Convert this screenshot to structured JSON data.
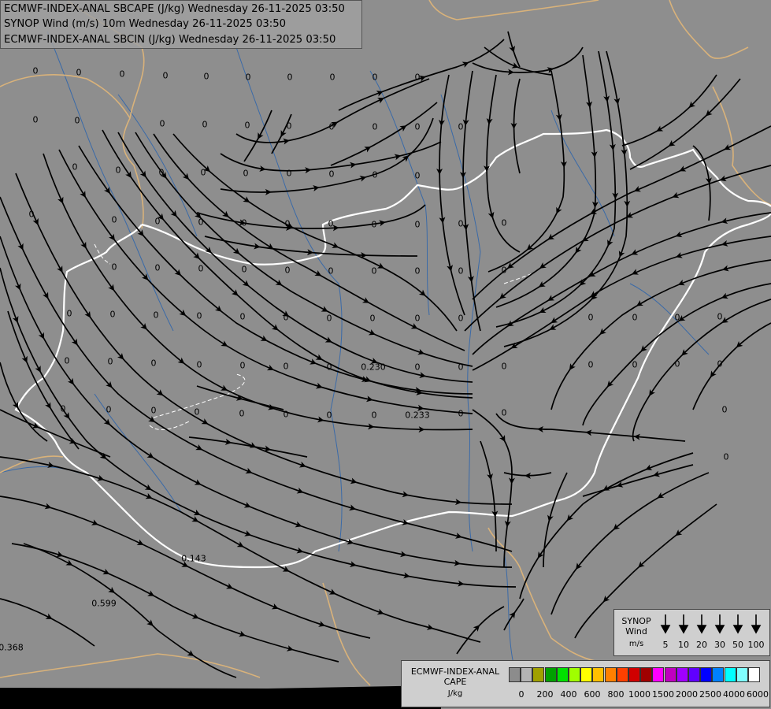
{
  "titles": {
    "line1": "ECMWF-INDEX-ANAL SBCAPE (J/kg) Wednesday 26-11-2025 03:50",
    "line2": "SYNOP Wind (m/s) 10m Wednesday 26-11-2025 03:50",
    "line3": "ECMWF-INDEX-ANAL SBCIN (J/kg) Wednesday 26-11-2025 03:50"
  },
  "field_labels": [
    "0",
    "0",
    "0",
    "0",
    "0",
    "0",
    "0",
    "0",
    "0",
    "0",
    "0",
    "0",
    "0",
    "0",
    "0",
    "0",
    "0",
    "0",
    "0",
    "0",
    "0",
    "0",
    "0",
    "0",
    "0",
    "0",
    "0",
    "0",
    "0",
    "0",
    "0",
    "0",
    "0",
    "0",
    "0",
    "0",
    "0",
    "0",
    "0",
    "0",
    "0",
    "0",
    "0",
    "0",
    "0",
    "0",
    "0",
    "0",
    "0",
    "0",
    "0",
    "0",
    "0",
    "0",
    "0",
    "0",
    "0",
    "0",
    "0",
    "0",
    "0",
    "0",
    "0",
    "0",
    "0",
    "0",
    "0",
    "0",
    "0",
    "0",
    "0",
    "0",
    "0",
    "0",
    "0",
    "0",
    "0",
    "0",
    "0",
    "0",
    "0",
    "0",
    "0",
    "0",
    "0",
    "0",
    "0",
    "0",
    "0",
    "0",
    "0.230",
    "0.233",
    "0.143",
    "0.599",
    "0.368"
  ],
  "synop_legend": {
    "title_line1": "SYNOP",
    "title_line2": "Wind",
    "unit": "m/s",
    "speeds": [
      "5",
      "10",
      "20",
      "30",
      "50",
      "100"
    ]
  },
  "cape_legend": {
    "title_line1": "ECMWF-INDEX-ANAL",
    "title_line2": "CAPE",
    "unit": "J/kg",
    "ticks": [
      "0",
      "200",
      "400",
      "600",
      "800",
      "1000",
      "1500",
      "2000",
      "2500",
      "4000",
      "6000"
    ],
    "colors": [
      "#8c8c8c",
      "#b4b4b4",
      "#a0a000",
      "#00a000",
      "#00e000",
      "#a0ff00",
      "#ffff00",
      "#ffc000",
      "#ff8000",
      "#ff4000",
      "#d00000",
      "#a00000",
      "#ff00ff",
      "#c000c0",
      "#a000ff",
      "#6000ff",
      "#0000ff",
      "#0080ff",
      "#00ffff",
      "#80ffff",
      "#ffffff"
    ]
  }
}
